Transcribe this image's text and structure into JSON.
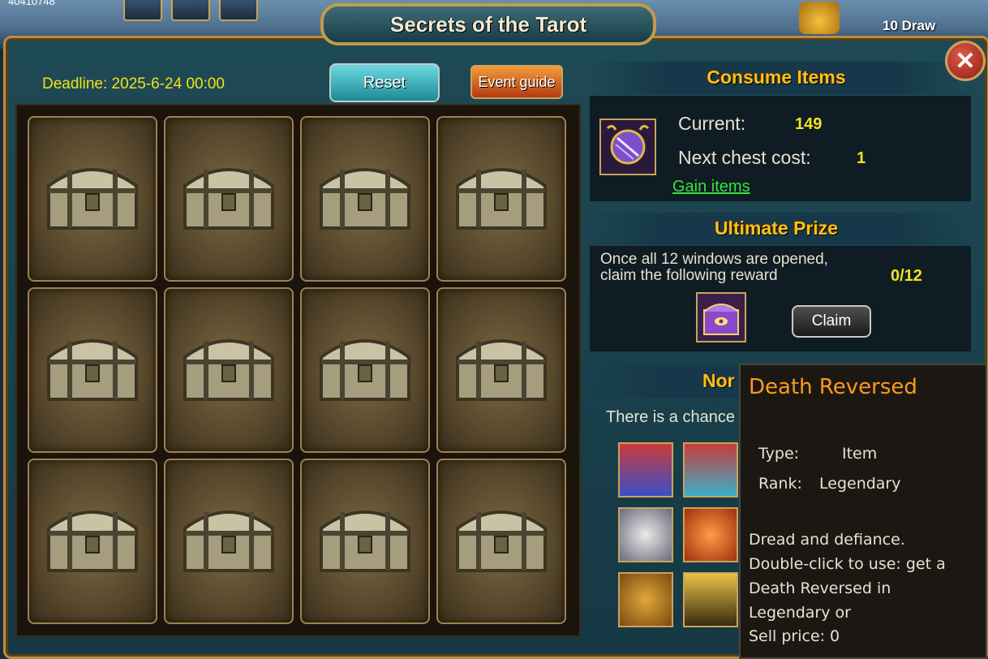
{
  "hud": {
    "corner_number": "40410748",
    "draw_label": "10 Draw"
  },
  "window": {
    "title": "Secrets of the Tarot",
    "close_glyph": "✕"
  },
  "toolbar": {
    "deadline": "Deadline: 2025-6-24 00:00",
    "reset_label": "Reset",
    "guide_label": "Event guide"
  },
  "chests": {
    "count": 12,
    "icon": "treasure-chest-icon"
  },
  "consume": {
    "header": "Consume Items",
    "current_label": "Current:",
    "current_value": "149",
    "next_label": "Next chest cost:",
    "next_value": "1",
    "gain_link": "Gain items"
  },
  "ultimate": {
    "header": "Ultimate Prize",
    "line1": "Once all 12 windows are opened,",
    "line2": "claim the following reward",
    "progress": "0/12",
    "claim_label": "Claim"
  },
  "normal": {
    "header_visible": "Nor",
    "chance_text": "There is a chance"
  },
  "tooltip": {
    "title": "Death Reversed",
    "type_label": "Type:",
    "type_value": "Item",
    "rank_label": "Rank:",
    "rank_value": "Legendary",
    "description": "Dread and defiance. Double-click to use: get a Death Reversed in Legendary or",
    "sell_label": "Sell price:",
    "sell_value": "0"
  },
  "colors": {
    "gold_text": "#f7c21c",
    "yellow_value": "#f2e21a",
    "link_green": "#34e53a",
    "tooltip_title": "#ff9a1a"
  }
}
